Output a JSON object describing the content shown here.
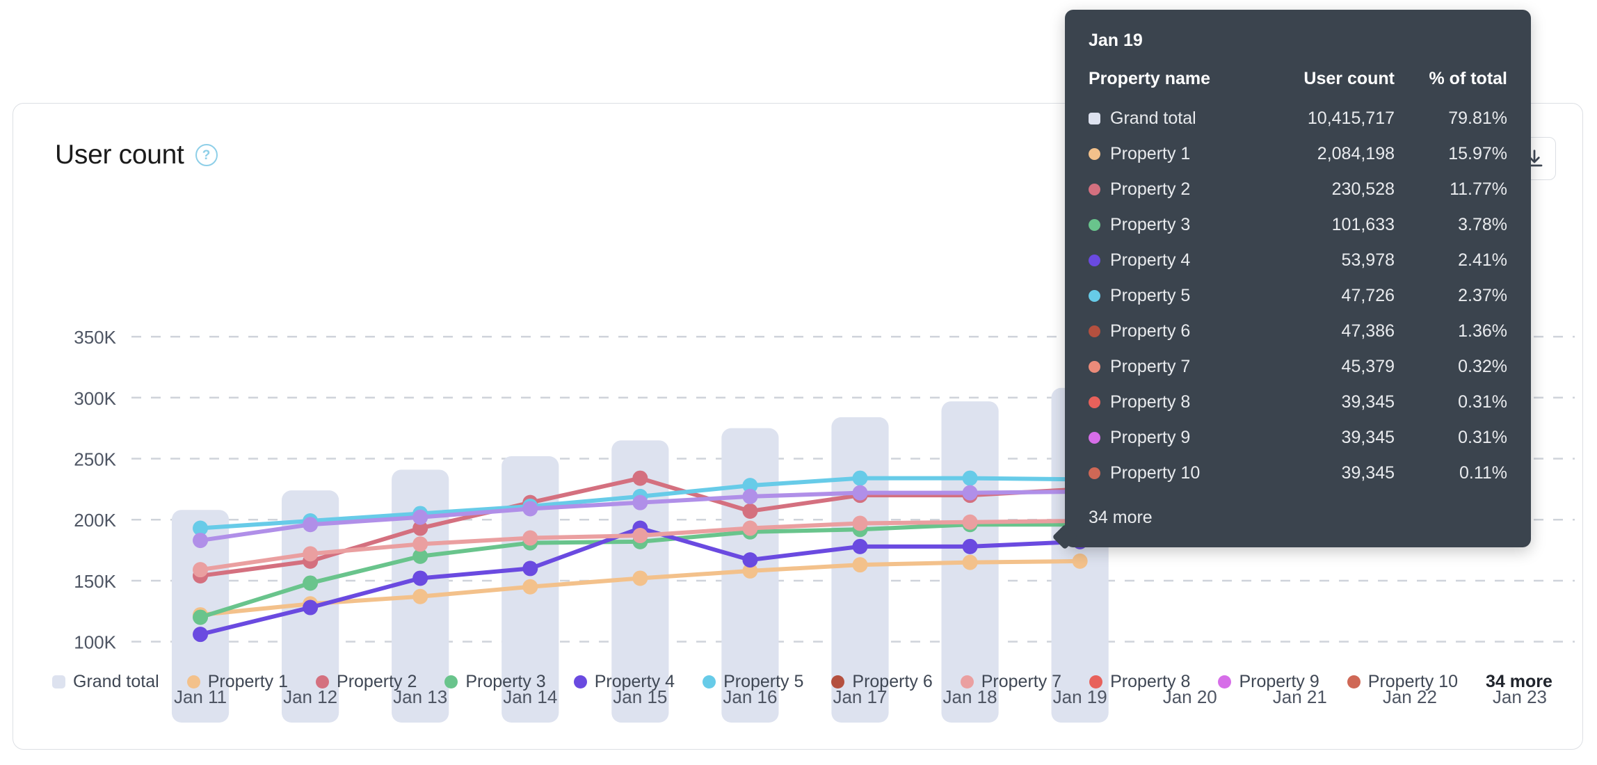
{
  "card": {
    "title": "User count",
    "help_icon": "question-circle-icon",
    "export_icon": "download-icon"
  },
  "chart_data": {
    "type": "line",
    "title": "User count",
    "xlabel": "",
    "ylabel": "",
    "ylim": [
      85000,
      370000
    ],
    "grid": true,
    "legend_position": "bottom",
    "categories": [
      "Jan 11",
      "Jan 12",
      "Jan 13",
      "Jan 14",
      "Jan 15",
      "Jan 16",
      "Jan 17",
      "Jan 18",
      "Jan 19",
      "Jan 20",
      "Jan 21",
      "Jan 22",
      "Jan 23"
    ],
    "tick_labels_y": [
      "100K",
      "150K",
      "200K",
      "250K",
      "300K",
      "350K"
    ],
    "tick_values_y": [
      100000,
      150000,
      200000,
      250000,
      300000,
      350000
    ],
    "bar_series": {
      "name": "Grand total",
      "type": "bar",
      "color": "#dde2ef",
      "values": [
        208000,
        224000,
        241000,
        252000,
        265000,
        275000,
        284000,
        297000,
        308000,
        null,
        null,
        null,
        null
      ]
    },
    "series": [
      {
        "name": "Property 1",
        "color": "#f3c18b",
        "values": [
          122000,
          131000,
          137000,
          145000,
          152000,
          158000,
          163000,
          165000,
          166000,
          null,
          null,
          null,
          null
        ]
      },
      {
        "name": "Property 2",
        "color": "#d4707f",
        "values": [
          154000,
          166000,
          193000,
          214000,
          234000,
          207000,
          220000,
          220000,
          225000,
          null,
          null,
          null,
          null
        ]
      },
      {
        "name": "Property 3",
        "color": "#69c48c",
        "values": [
          120000,
          148000,
          170000,
          181000,
          182000,
          190000,
          192000,
          196000,
          196000,
          null,
          null,
          null,
          null
        ]
      },
      {
        "name": "Property 4",
        "color": "#6a4ae0",
        "values": [
          106000,
          128000,
          152000,
          160000,
          193000,
          167000,
          178000,
          178000,
          182000,
          null,
          null,
          null,
          null
        ]
      },
      {
        "name": "Property 5",
        "color": "#67cbe8",
        "values": [
          193000,
          199000,
          205000,
          211000,
          219000,
          228000,
          234000,
          234000,
          233000,
          null,
          null,
          null,
          null
        ]
      },
      {
        "name": "Property 6",
        "color": "#b4503f",
        "values": [
          null,
          null,
          null,
          null,
          null,
          null,
          null,
          null,
          null,
          null,
          null,
          null,
          null
        ]
      },
      {
        "name": "Property 7",
        "color": "#ea9fa0",
        "values": [
          159000,
          172000,
          180000,
          185000,
          187000,
          193000,
          197000,
          198000,
          199000,
          null,
          null,
          null,
          null
        ]
      },
      {
        "name": "Property 8",
        "color": "#e8615b",
        "values": [
          null,
          null,
          null,
          null,
          null,
          null,
          null,
          null,
          null,
          null,
          null,
          null,
          null
        ]
      },
      {
        "name": "Property 9",
        "color": "#b08fe8",
        "values": [
          183000,
          196000,
          202000,
          209000,
          214000,
          219000,
          222000,
          222000,
          223000,
          null,
          null,
          null,
          null
        ]
      },
      {
        "name": "Property 10",
        "color": "#cf6856",
        "values": [
          null,
          null,
          null,
          null,
          null,
          null,
          null,
          null,
          null,
          null,
          null,
          null,
          null
        ]
      }
    ]
  },
  "legend": {
    "items": [
      {
        "label": "Grand total",
        "color": "#dde2ef",
        "shape": "square"
      },
      {
        "label": "Property 1",
        "color": "#f3c18b",
        "shape": "circle"
      },
      {
        "label": "Property 2",
        "color": "#d4707f",
        "shape": "circle"
      },
      {
        "label": "Property 3",
        "color": "#69c48c",
        "shape": "circle"
      },
      {
        "label": "Property 4",
        "color": "#6a4ae0",
        "shape": "circle"
      },
      {
        "label": "Property 5",
        "color": "#67cbe8",
        "shape": "circle"
      },
      {
        "label": "Property 6",
        "color": "#b4503f",
        "shape": "circle"
      },
      {
        "label": "Property 7",
        "color": "#ea9fa0",
        "shape": "circle"
      },
      {
        "label": "Property 8",
        "color": "#e8615b",
        "shape": "circle"
      },
      {
        "label": "Property 9",
        "color": "#d66ee8",
        "shape": "circle"
      },
      {
        "label": "Property 10",
        "color": "#cf6856",
        "shape": "circle"
      }
    ],
    "more_label": "34 more"
  },
  "tooltip": {
    "date": "Jan 19",
    "columns": [
      "Property name",
      "User count",
      "% of  total"
    ],
    "rows": [
      {
        "name": "Grand total",
        "color": "#dde2ef",
        "shape": "square",
        "count": "10,415,717",
        "pct": "79.81%"
      },
      {
        "name": "Property 1",
        "color": "#f3c18b",
        "shape": "circle",
        "count": "2,084,198",
        "pct": "15.97%"
      },
      {
        "name": "Property 2",
        "color": "#d4707f",
        "shape": "circle",
        "count": "230,528",
        "pct": "11.77%"
      },
      {
        "name": "Property 3",
        "color": "#69c48c",
        "shape": "circle",
        "count": "101,633",
        "pct": "3.78%"
      },
      {
        "name": "Property 4",
        "color": "#6a4ae0",
        "shape": "circle",
        "count": "53,978",
        "pct": "2.41%"
      },
      {
        "name": "Property 5",
        "color": "#67cbe8",
        "shape": "circle",
        "count": "47,726",
        "pct": "2.37%"
      },
      {
        "name": "Property 6",
        "color": "#b4503f",
        "shape": "circle",
        "count": "47,386",
        "pct": "1.36%"
      },
      {
        "name": "Property 7",
        "color": "#ea8b7a",
        "shape": "circle",
        "count": "45,379",
        "pct": "0.32%"
      },
      {
        "name": "Property 8",
        "color": "#e8615b",
        "shape": "circle",
        "count": "39,345",
        "pct": "0.31%"
      },
      {
        "name": "Property 9",
        "color": "#d66ee8",
        "shape": "circle",
        "count": "39,345",
        "pct": "0.31%"
      },
      {
        "name": "Property 10",
        "color": "#cf6856",
        "shape": "circle",
        "count": "39,345",
        "pct": "0.11%"
      }
    ],
    "more_label": "34 more"
  }
}
